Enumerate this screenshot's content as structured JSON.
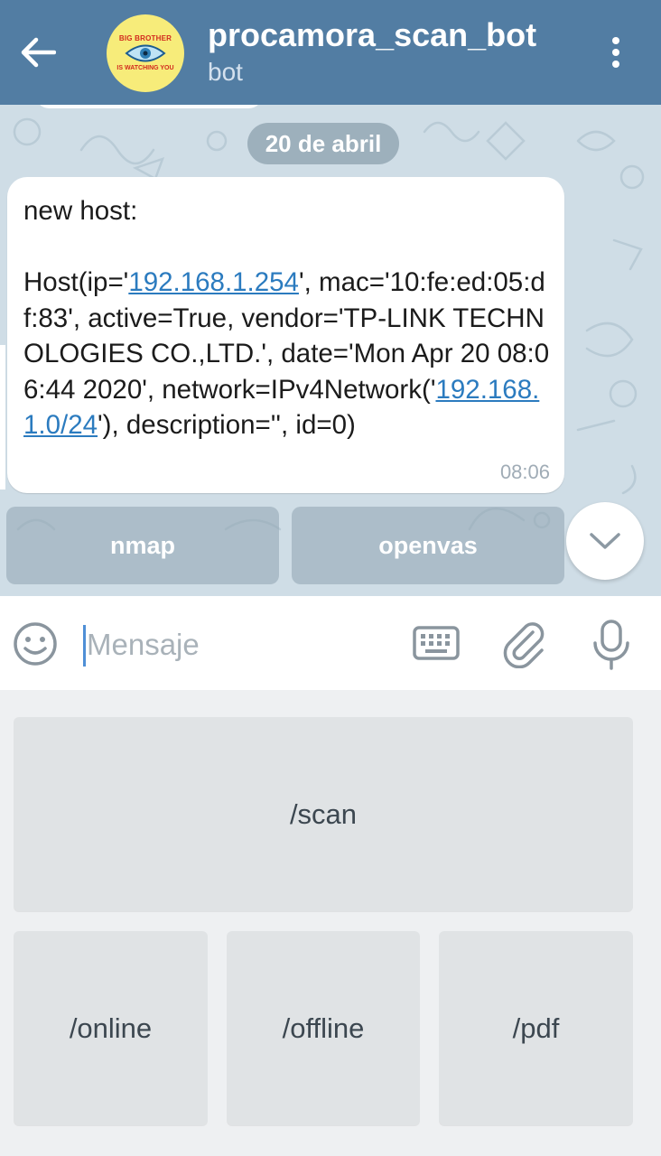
{
  "header": {
    "title": "procamora_scan_bot",
    "subtitle": "bot",
    "avatar_text_top": "BIG BROTHER",
    "avatar_text_bottom": "IS WATCHING YOU",
    "colors": {
      "header_bg": "#527da3",
      "chat_bg": "#cfdde6",
      "link": "#2b7bbf"
    }
  },
  "chat": {
    "date_chip": "20 de abril",
    "message": {
      "line1": "new host:",
      "host_prefix": "Host(ip='",
      "ip_link": "192.168.1.254",
      "host_mid": "', mac='10:fe:ed:05:df:83', active=True, vendor='TP-LINK TECHNOLOGIES CO.,LTD.', date='Mon Apr 20 08:06:44 2020', network=IPv4Network('",
      "network_link": "192.168.1.0/24",
      "host_suffix": "'), description='', id=0)",
      "time": "08:06"
    },
    "inline_buttons": [
      "nmap",
      "openvas"
    ]
  },
  "input": {
    "placeholder": "Mensaje"
  },
  "reply_keyboard": {
    "row1": [
      "/scan"
    ],
    "row2": [
      "/online",
      "/offline",
      "/pdf"
    ]
  },
  "icons": {
    "back": "arrow-left-icon",
    "menu": "more-vertical-icon",
    "scroll": "chevron-down-icon",
    "emoji": "smiley-icon",
    "keyboard": "keyboard-icon",
    "attach": "paperclip-icon",
    "mic": "microphone-icon"
  }
}
